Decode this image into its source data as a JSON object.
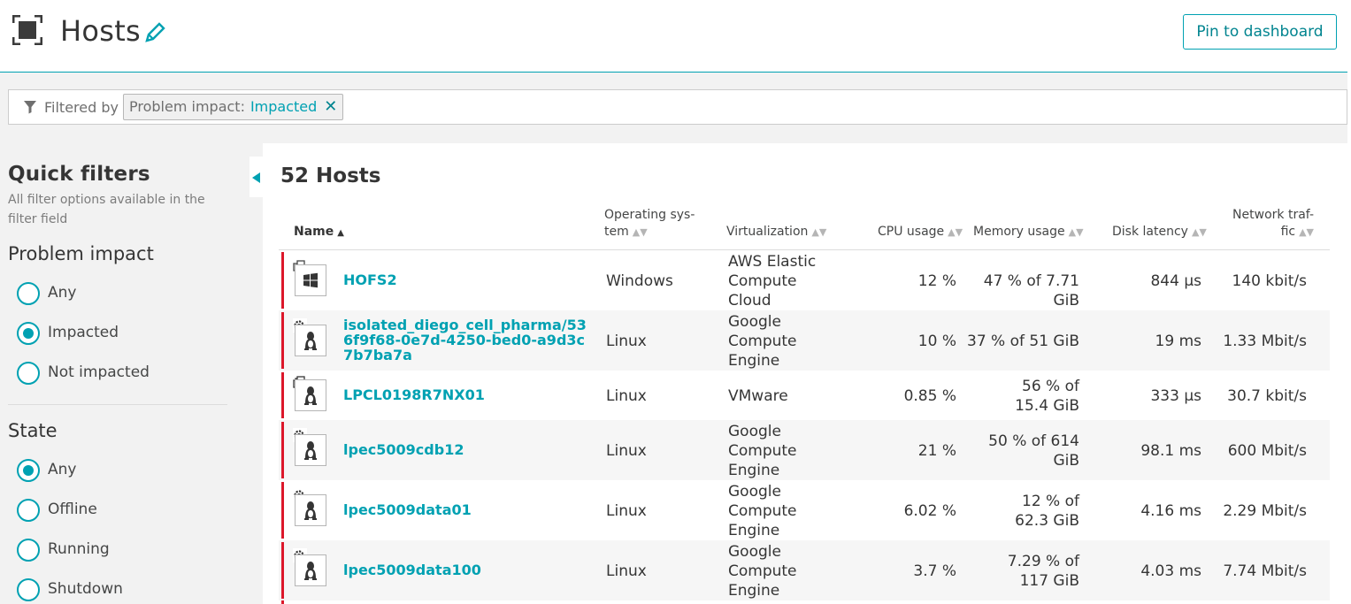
{
  "header": {
    "title": "Hosts",
    "pin_label": "Pin to dashboard"
  },
  "filter": {
    "filtered_by": "Filtered by",
    "chip_key": "Problem impact:",
    "chip_value": "Impacted"
  },
  "sidebar": {
    "title": "Quick filters",
    "subtitle": "All filter options available in the filter field",
    "problem_impact": {
      "title": "Problem impact",
      "options": [
        "Any",
        "Impacted",
        "Not impacted"
      ],
      "selected": "Impacted"
    },
    "state": {
      "title": "State",
      "options": [
        "Any",
        "Offline",
        "Running",
        "Shutdown"
      ],
      "selected": "Any"
    }
  },
  "table": {
    "count_label": "52 Hosts",
    "columns": {
      "name": "Name",
      "os_line1": "Operating sys-",
      "os_line2": "tem",
      "virt": "Virtualization",
      "cpu": "CPU usage",
      "mem": "Memory usage",
      "disk": "Disk latency",
      "net_line1": "Network traf-",
      "net_line2": "fic"
    },
    "rows": [
      {
        "name": "HOFS2",
        "os": "Windows",
        "os_icon": "windows-icon",
        "virt": "AWS Elastic Compute Cloud",
        "cpu": "12 %",
        "mem": "47 % of 7.71 GiB",
        "disk": "844 µs",
        "net": "140 kbit/s"
      },
      {
        "name": "isolated_diego_cell_pharma/536f9f68-0e7d-4250-bed0-a9d3c7b7ba7a",
        "os": "Linux",
        "os_icon": "linux-icon",
        "virt": "Google Compute Engine",
        "cpu": "10 %",
        "mem": "37 % of 51 GiB",
        "disk": "19 ms",
        "net": "1.33 Mbit/s"
      },
      {
        "name": "LPCL0198R7NX01",
        "os": "Linux",
        "os_icon": "linux-icon",
        "virt": "VMware",
        "cpu": "0.85 %",
        "mem": "56 % of 15.4 GiB",
        "disk": "333 µs",
        "net": "30.7 kbit/s"
      },
      {
        "name": "lpec5009cdb12",
        "os": "Linux",
        "os_icon": "linux-icon",
        "virt": "Google Compute Engine",
        "cpu": "21 %",
        "mem": "50 % of 614 GiB",
        "disk": "98.1 ms",
        "net": "600 Mbit/s"
      },
      {
        "name": "lpec5009data01",
        "os": "Linux",
        "os_icon": "linux-icon",
        "virt": "Google Compute Engine",
        "cpu": "6.02 %",
        "mem": "12 % of 62.3 GiB",
        "disk": "4.16 ms",
        "net": "2.29 Mbit/s"
      },
      {
        "name": "lpec5009data100",
        "os": "Linux",
        "os_icon": "linux-icon",
        "virt": "Google Compute Engine",
        "cpu": "3.7 %",
        "mem": "7.29 % of 117 GiB",
        "disk": "4.03 ms",
        "net": "7.74 Mbit/s"
      }
    ]
  },
  "colors": {
    "accent": "#00a1b2",
    "problem": "#dc172a"
  }
}
